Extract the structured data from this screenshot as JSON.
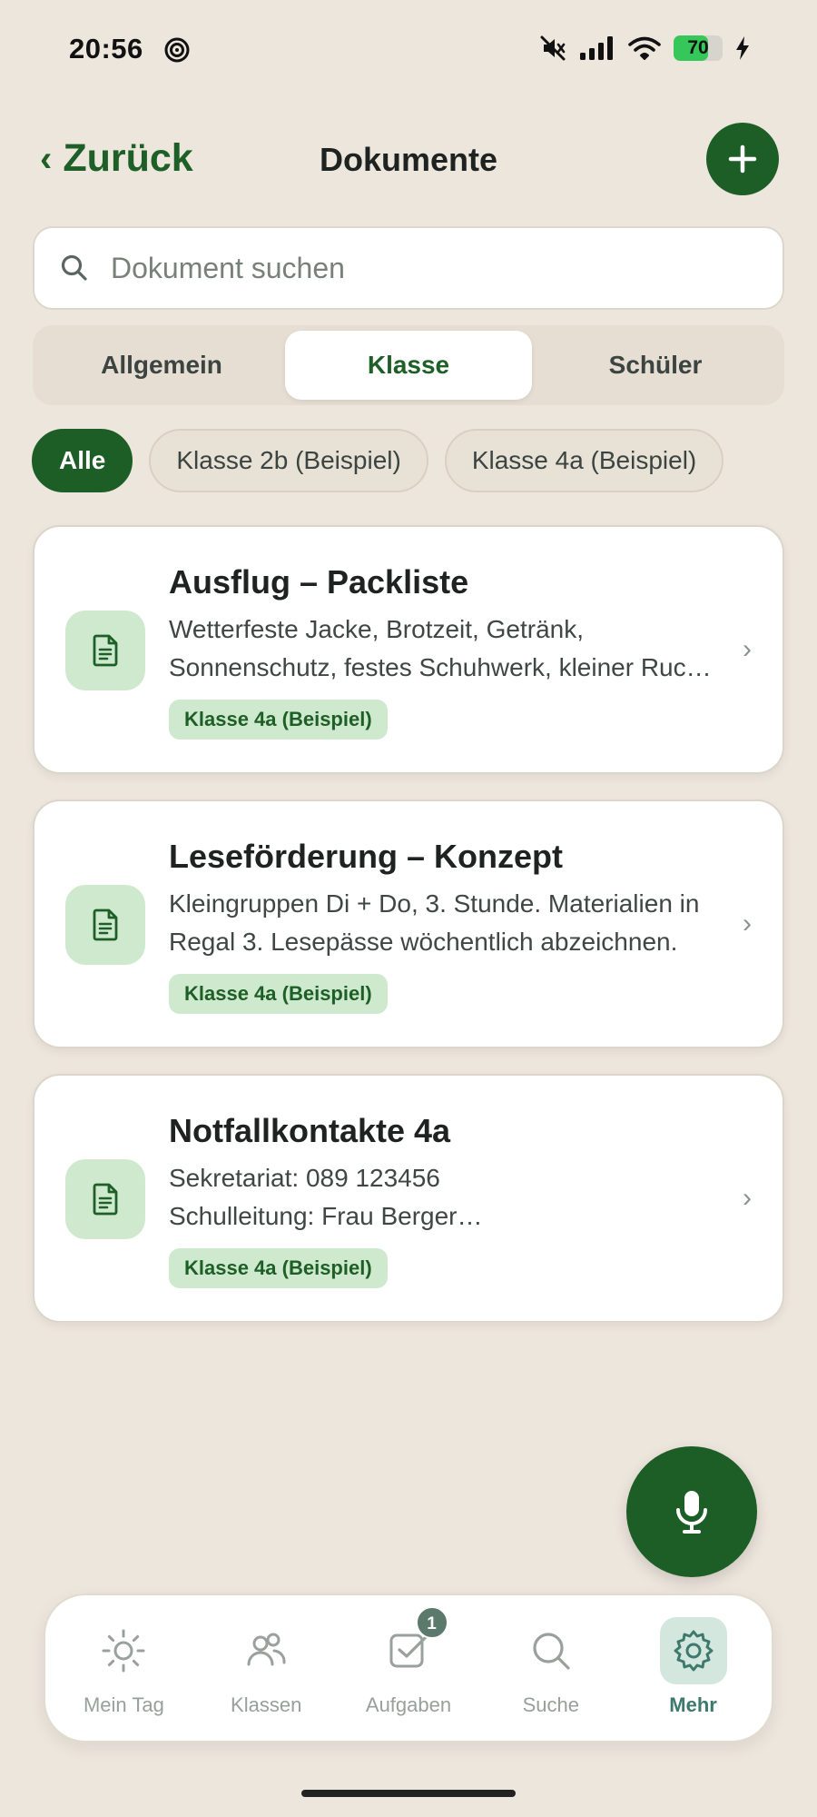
{
  "status_bar": {
    "time": "20:56",
    "battery_level": "70"
  },
  "header": {
    "back_label": "Zurück",
    "title": "Dokumente"
  },
  "search": {
    "placeholder": "Dokument suchen",
    "value": ""
  },
  "segments": [
    {
      "label": "Allgemein",
      "active": false
    },
    {
      "label": "Klasse",
      "active": true
    },
    {
      "label": "Schüler",
      "active": false
    }
  ],
  "filters": [
    {
      "label": "Alle",
      "active": true
    },
    {
      "label": "Klasse 2b (Beispiel)",
      "active": false
    },
    {
      "label": "Klasse 4a (Beispiel)",
      "active": false
    }
  ],
  "documents": [
    {
      "title": "Ausflug – Packliste",
      "desc_line1": "Wetterfeste Jacke, Brotzeit, Getränk,",
      "desc_line2": "Sonnenschutz, festes Schuhwerk, kleiner Rucksack",
      "badge": "Klasse 4a (Beispiel)"
    },
    {
      "title": "Leseförderung – Konzept",
      "desc_line1": "Kleingruppen Di + Do, 3. Stunde. Materialien in",
      "desc_line2": "Regal 3. Lesepässe wöchentlich abzeichnen.",
      "badge": "Klasse 4a (Beispiel)"
    },
    {
      "title": "Notfallkontakte 4a",
      "desc_line1": "Sekretariat: 089 123456",
      "desc_line2": "Schulleitung: Frau Berger…",
      "badge": "Klasse 4a (Beispiel)"
    }
  ],
  "tabbar": [
    {
      "label": "Mein Tag",
      "icon": "sun-icon",
      "active": false
    },
    {
      "label": "Klassen",
      "icon": "users-icon",
      "active": false
    },
    {
      "label": "Aufgaben",
      "icon": "checkbox-icon",
      "active": false,
      "badge": "1"
    },
    {
      "label": "Suche",
      "icon": "search-icon",
      "active": false
    },
    {
      "label": "Mehr",
      "icon": "gear-icon",
      "active": true
    }
  ],
  "colors": {
    "background": "#ede6dd",
    "primary": "#1c5e25",
    "badge_bg": "#cfe9cf",
    "active_tab_bg": "#d4e7df"
  }
}
